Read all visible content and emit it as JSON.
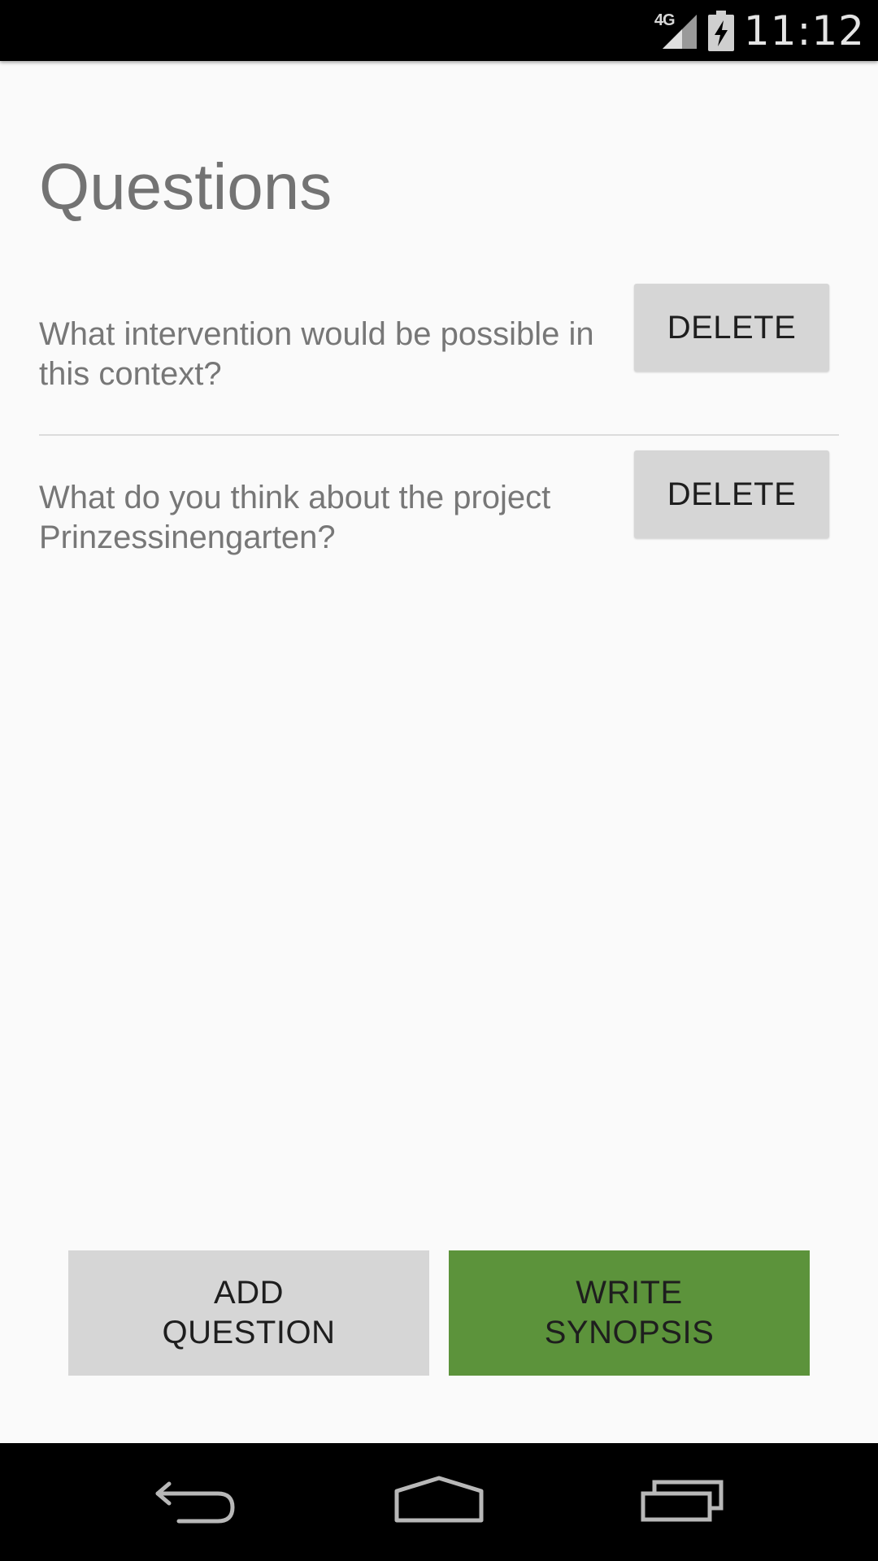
{
  "status_bar": {
    "network_label": "4G",
    "time": "11:12",
    "icons": [
      "signal-icon",
      "battery-charging-icon"
    ]
  },
  "page": {
    "title": "Questions"
  },
  "questions": [
    {
      "text": "What intervention would be possible in this context?",
      "delete_label": "DELETE"
    },
    {
      "text": "What do you think about the project Prinzessinengarten?",
      "delete_label": "DELETE"
    }
  ],
  "actions": {
    "add_question_line1": "ADD",
    "add_question_line2": "QUESTION",
    "write_synopsis_line1": "WRITE",
    "write_synopsis_line2": "SYNOPSIS"
  },
  "navigation": {
    "icons": [
      "back-icon",
      "home-icon",
      "recents-icon"
    ]
  },
  "colors": {
    "background": "#fafafa",
    "status_bar": "#000000",
    "button_grey": "#d6d6d6",
    "accent_green": "#5c933b",
    "text_grey": "#777777"
  }
}
